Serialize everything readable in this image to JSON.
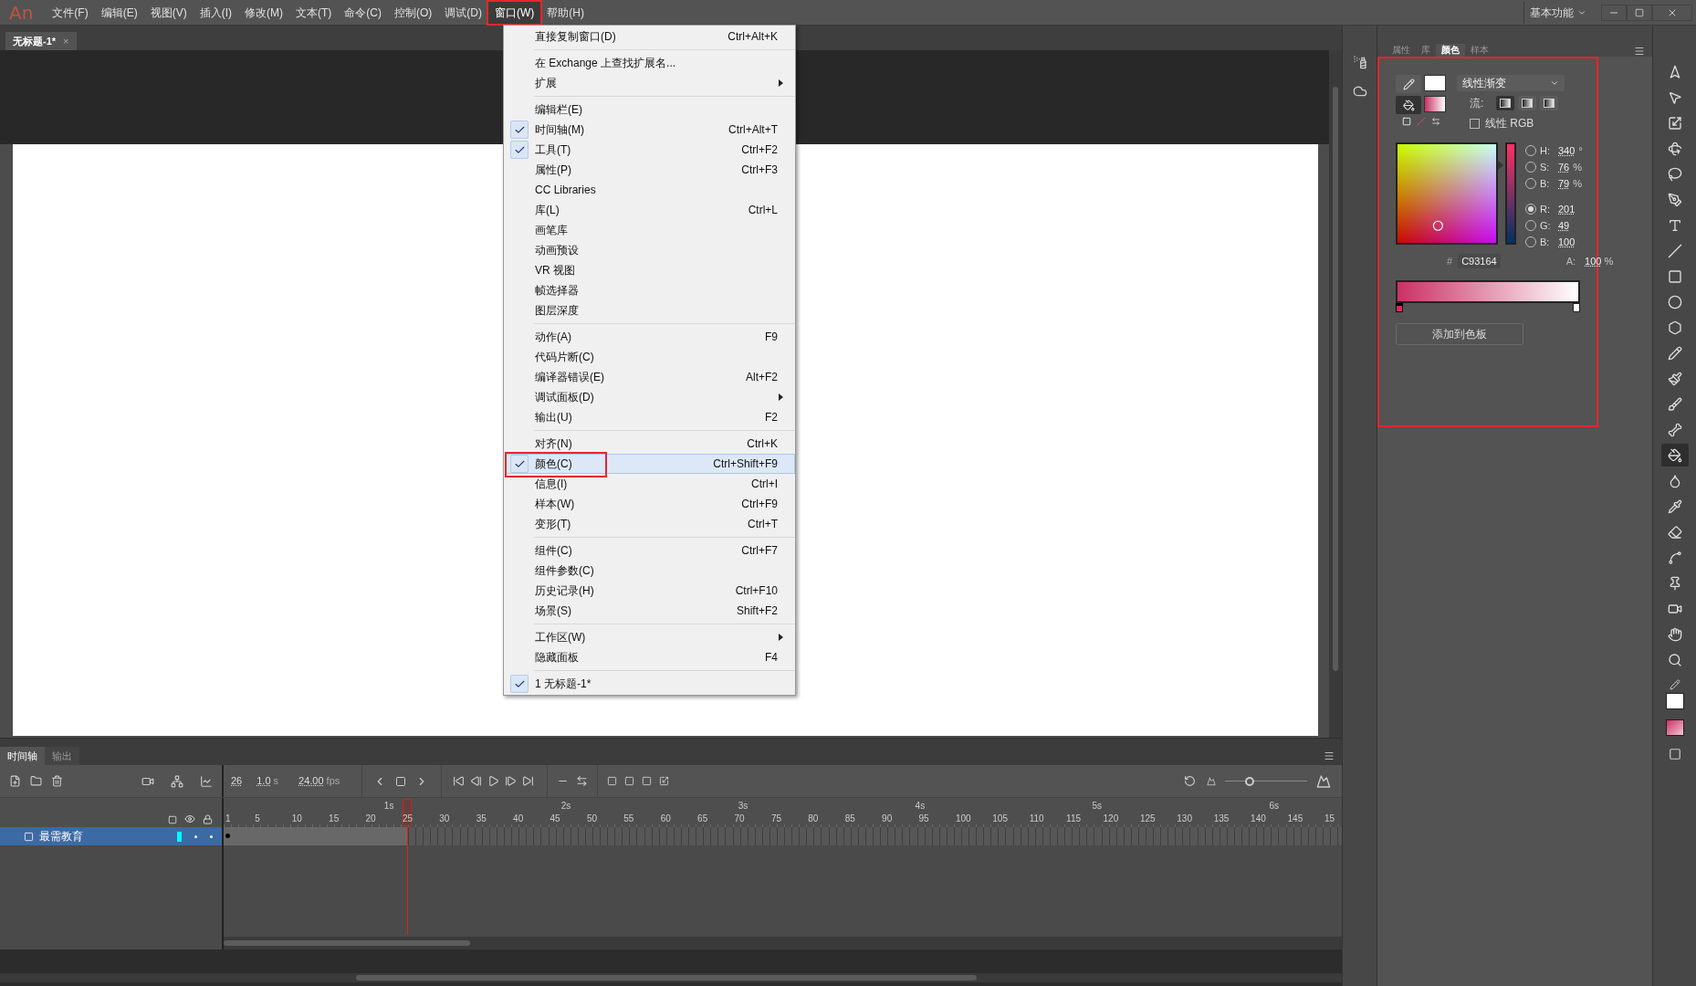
{
  "app_logo": "An",
  "menu_bar": [
    {
      "label": "文件(F)",
      "selected": false
    },
    {
      "label": "编辑(E)",
      "selected": false
    },
    {
      "label": "视图(V)",
      "selected": false
    },
    {
      "label": "插入(I)",
      "selected": false
    },
    {
      "label": "修改(M)",
      "selected": false
    },
    {
      "label": "文本(T)",
      "selected": false
    },
    {
      "label": "命令(C)",
      "selected": false
    },
    {
      "label": "控制(O)",
      "selected": false
    },
    {
      "label": "调试(D)",
      "selected": false
    },
    {
      "label": "窗口(W)",
      "selected": true,
      "marked": true
    },
    {
      "label": "帮助(H)",
      "selected": false
    }
  ],
  "workspace": "基本功能",
  "document_tab": {
    "title": "无标题-1*",
    "close": "×"
  },
  "window_menu": [
    [
      {
        "label": "直接复制窗口(D)",
        "shortcut": "Ctrl+Alt+K",
        "checked": false
      }
    ],
    [
      {
        "label": "在 Exchange 上查找扩展名...",
        "checked": false
      },
      {
        "label": "扩展",
        "checked": false,
        "submenu": true
      }
    ],
    [
      {
        "label": "编辑栏(E)",
        "checked": false
      },
      {
        "label": "时间轴(M)",
        "shortcut": "Ctrl+Alt+T",
        "checked": true
      },
      {
        "label": "工具(T)",
        "shortcut": "Ctrl+F2",
        "checked": true
      },
      {
        "label": "属性(P)",
        "shortcut": "Ctrl+F3",
        "checked": false
      },
      {
        "label": "CC Libraries",
        "checked": false
      },
      {
        "label": "库(L)",
        "shortcut": "Ctrl+L",
        "checked": false
      },
      {
        "label": "画笔库",
        "checked": false
      },
      {
        "label": "动画预设",
        "checked": false
      },
      {
        "label": "VR 视图",
        "checked": false
      },
      {
        "label": "帧选择器",
        "checked": false
      },
      {
        "label": "图层深度",
        "checked": false
      }
    ],
    [
      {
        "label": "动作(A)",
        "shortcut": "F9",
        "checked": false
      },
      {
        "label": "代码片断(C)",
        "checked": false
      },
      {
        "label": "编译器错误(E)",
        "shortcut": "Alt+F2",
        "checked": false
      },
      {
        "label": "调试面板(D)",
        "checked": false,
        "submenu": true
      },
      {
        "label": "输出(U)",
        "shortcut": "F2",
        "checked": false
      }
    ],
    [
      {
        "label": "对齐(N)",
        "shortcut": "Ctrl+K",
        "checked": false
      },
      {
        "label": "颜色(C)",
        "shortcut": "Ctrl+Shift+F9",
        "checked": true,
        "selected": true,
        "marked": true
      },
      {
        "label": "信息(I)",
        "shortcut": "Ctrl+I",
        "checked": false
      },
      {
        "label": "样本(W)",
        "shortcut": "Ctrl+F9",
        "checked": false
      },
      {
        "label": "变形(T)",
        "shortcut": "Ctrl+T",
        "checked": false
      }
    ],
    [
      {
        "label": "组件(C)",
        "shortcut": "Ctrl+F7",
        "checked": false
      },
      {
        "label": "组件参数(C)",
        "checked": false
      },
      {
        "label": "历史记录(H)",
        "shortcut": "Ctrl+F10",
        "checked": false
      },
      {
        "label": "场景(S)",
        "shortcut": "Shift+F2",
        "checked": false
      }
    ],
    [
      {
        "label": "工作区(W)",
        "checked": false,
        "submenu": true
      },
      {
        "label": "隐藏面板",
        "shortcut": "F4",
        "checked": false
      }
    ],
    [
      {
        "label": "1 无标题-1*",
        "checked": true
      }
    ]
  ],
  "panel_tabs": [
    {
      "label": "属性",
      "selected": false
    },
    {
      "label": "库",
      "selected": false
    },
    {
      "label": "颜色",
      "selected": true
    },
    {
      "label": "样本",
      "selected": false
    }
  ],
  "color_panel": {
    "marked": true,
    "stroke": {
      "color": "#ffffff",
      "selected": false
    },
    "fill": {
      "selected": true
    },
    "fill_type": "线性渐变",
    "flow_label": "流:",
    "flow_modes": [
      {
        "selected": true
      },
      {
        "selected": false
      },
      {
        "selected": false
      }
    ],
    "linear_rgb": {
      "label": "线性 RGB",
      "checked": false
    },
    "channels": [
      {
        "label": "H:",
        "value": "340",
        "unit": "°",
        "selected": false
      },
      {
        "label": "S:",
        "value": "76",
        "unit": "%",
        "selected": false
      },
      {
        "label": "B:",
        "value": "79",
        "unit": "%",
        "selected": false
      },
      {
        "label": "R:",
        "value": "201",
        "selected": true
      },
      {
        "label": "G:",
        "value": "49",
        "selected": false
      },
      {
        "label": "B:",
        "value": "100",
        "selected": false
      }
    ],
    "alpha": {
      "label": "A:",
      "value": "100",
      "unit": "%"
    },
    "hex_label": "#",
    "hex": "C93164",
    "gradient_stops": [
      {
        "color": "#c93164",
        "level": 0,
        "selected": true
      },
      {
        "color": "#ffffff",
        "level": 1,
        "selected": false
      }
    ],
    "add_button": "添加到色板"
  },
  "tools": [
    {
      "kind": "selection",
      "selected": false
    },
    {
      "kind": "subselection",
      "selected": false
    },
    {
      "kind": "transform",
      "selected": false
    },
    {
      "kind": "rotate3d",
      "selected": false
    },
    {
      "kind": "lasso",
      "selected": false
    },
    {
      "kind": "pen",
      "selected": false
    },
    {
      "kind": "text",
      "selected": false
    },
    {
      "kind": "line",
      "selected": false
    },
    {
      "kind": "rectangle",
      "selected": false
    },
    {
      "kind": "oval",
      "selected": false
    },
    {
      "kind": "polygon",
      "selected": false
    },
    {
      "kind": "pencil",
      "selected": false
    },
    {
      "kind": "paintbrush",
      "selected": false
    },
    {
      "kind": "brush",
      "selected": false
    },
    {
      "kind": "bone",
      "selected": false
    },
    {
      "kind": "bucket",
      "selected": true
    },
    {
      "kind": "ink",
      "selected": false
    },
    {
      "kind": "eyedropper",
      "selected": false
    },
    {
      "kind": "eraser",
      "selected": false
    },
    {
      "kind": "width",
      "selected": false
    },
    {
      "kind": "pin",
      "selected": false
    },
    {
      "kind": "camera",
      "selected": false
    },
    {
      "kind": "hand",
      "selected": false
    },
    {
      "kind": "zoom",
      "selected": false
    }
  ],
  "timeline": {
    "tabs": [
      {
        "label": "时间轴",
        "selected": true
      },
      {
        "label": "输出",
        "selected": false
      }
    ],
    "current_frame": "26",
    "elapsed": "1.0",
    "elapsed_unit": "s",
    "fps": "24.00",
    "fps_unit": "fps",
    "zoom": {
      "level": 0.3
    },
    "seconds": [
      "1s",
      "2s",
      "3s",
      "4s",
      "5s",
      "6s"
    ],
    "frame_numbers": [
      "1",
      "5",
      "10",
      "15",
      "20",
      "25",
      "30",
      "35",
      "40",
      "45",
      "50",
      "55",
      "60",
      "65",
      "70",
      "75",
      "80",
      "85",
      "90",
      "95",
      "100",
      "105",
      "110",
      "115",
      "120",
      "125",
      "130",
      "135",
      "140",
      "145",
      "15"
    ],
    "playhead": {
      "level": 0.16
    },
    "layers": [
      {
        "name": "最需教育",
        "selected": true,
        "color": "#00ffff"
      }
    ]
  }
}
